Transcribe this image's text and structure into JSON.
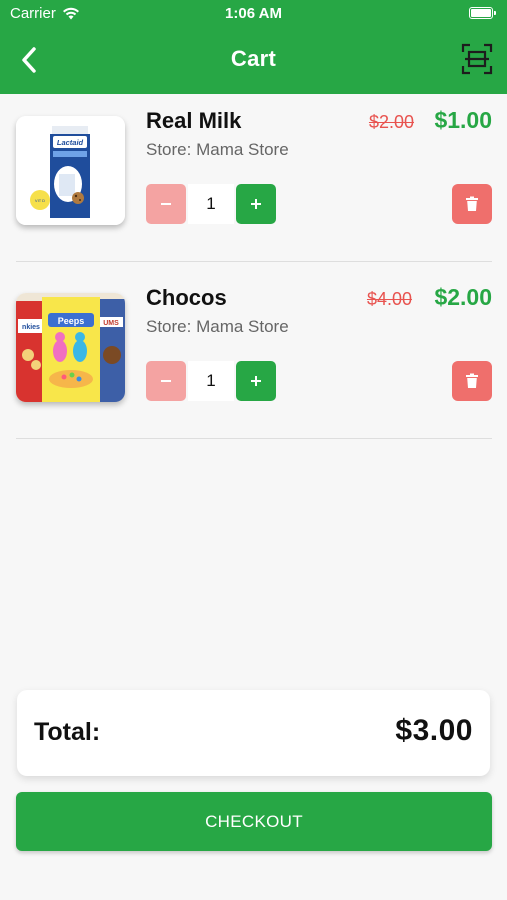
{
  "status_bar": {
    "carrier": "Carrier",
    "time": "1:06 AM"
  },
  "nav": {
    "title": "Cart",
    "back_icon": "chevron-left-icon",
    "scan_icon": "scan-frame-icon"
  },
  "items": [
    {
      "name": "Real Milk",
      "store": "Store: Mama Store",
      "old_price": "$2.00",
      "price": "$1.00",
      "quantity": "1",
      "image": "milk-carton-image"
    },
    {
      "name": "Chocos",
      "store": "Store: Mama Store",
      "old_price": "$4.00",
      "price": "$2.00",
      "quantity": "1",
      "image": "cereal-boxes-image"
    }
  ],
  "total": {
    "label": "Total:",
    "value": "$3.00"
  },
  "checkout": {
    "label": "CHECKOUT"
  },
  "colors": {
    "primary": "#27a745",
    "danger": "#ef6f6c",
    "danger_light": "#f4a3a2",
    "strike": "#e8534f"
  }
}
